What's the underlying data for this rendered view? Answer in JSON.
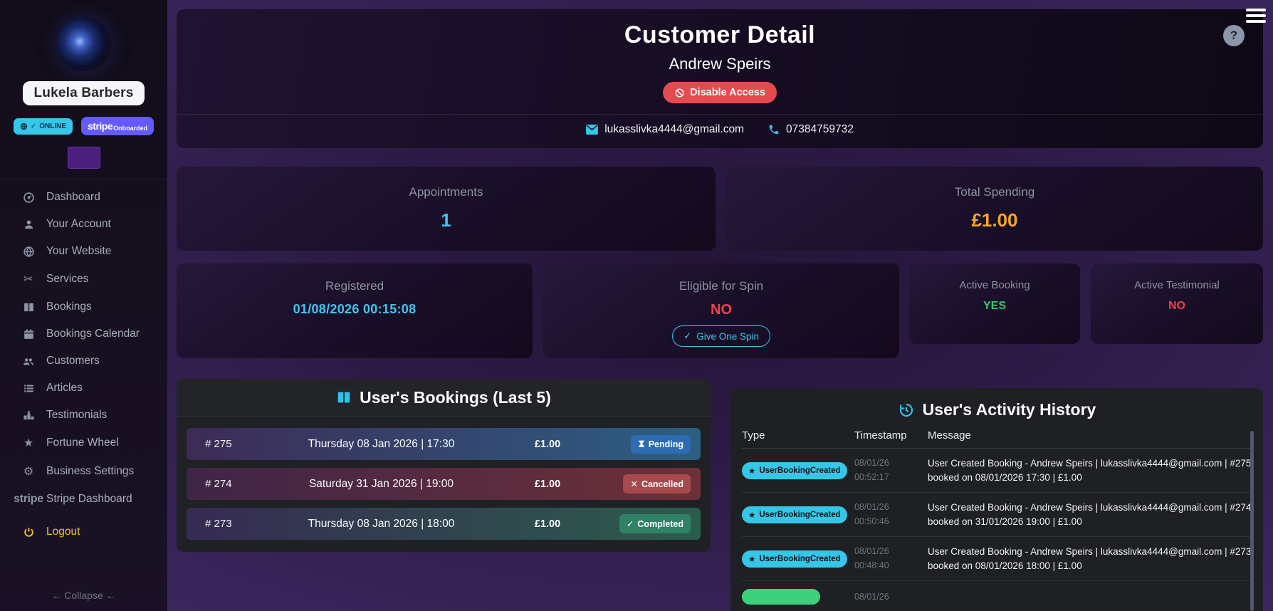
{
  "brand": {
    "name": "Lukela Barbers",
    "online_badge": "ONLINE",
    "stripe_badge_word": "stripe",
    "stripe_badge_sub": "Onboarded"
  },
  "sidebar": {
    "items": [
      {
        "icon": "dashboard",
        "label": "Dashboard"
      },
      {
        "icon": "person",
        "label": "Your Account"
      },
      {
        "icon": "globe",
        "label": "Your Website"
      },
      {
        "icon": "scissors",
        "label": "Services"
      },
      {
        "icon": "book",
        "label": "Bookings"
      },
      {
        "icon": "calendar",
        "label": "Bookings Calendar"
      },
      {
        "icon": "people",
        "label": "Customers"
      },
      {
        "icon": "list",
        "label": "Articles"
      },
      {
        "icon": "podium",
        "label": "Testimonials"
      },
      {
        "icon": "star",
        "label": "Fortune Wheel"
      },
      {
        "icon": "gears",
        "label": "Business Settings"
      },
      {
        "icon": "stripe",
        "label": "Stripe Dashboard",
        "icon_text": "stripe"
      },
      {
        "icon": "power",
        "label": "Logout"
      }
    ],
    "collapse_label": "← Collapse ←"
  },
  "header": {
    "title": "Customer Detail",
    "subtitle": "Andrew Speirs",
    "disable_button_label": "Disable Access",
    "email": "lukasslivka4444@gmail.com",
    "phone": "07384759732"
  },
  "stats": {
    "appointments": {
      "label": "Appointments",
      "value": "1"
    },
    "total_spending": {
      "label": "Total Spending",
      "value": "£1.00"
    },
    "registered": {
      "label": "Registered",
      "value": "01/08/2026 00:15:08"
    },
    "eligible_spin": {
      "label": "Eligible for Spin",
      "value": "NO",
      "button_label": "Give One Spin"
    },
    "active_booking": {
      "label": "Active Booking",
      "value": "YES"
    },
    "active_testimonial": {
      "label": "Active Testimonial",
      "value": "NO"
    }
  },
  "bookings": {
    "title": "User's Bookings (Last 5)",
    "rows": [
      {
        "id": "# 275",
        "datetime": "Thursday 08 Jan 2026 | 17:30",
        "price": "£1.00",
        "status": "Pending"
      },
      {
        "id": "# 274",
        "datetime": "Saturday 31 Jan 2026 | 19:00",
        "price": "£1.00",
        "status": "Cancelled"
      },
      {
        "id": "# 273",
        "datetime": "Thursday 08 Jan 2026 | 18:00",
        "price": "£1.00",
        "status": "Completed"
      }
    ],
    "status_icons": {
      "cancelled": "✕",
      "completed": "✓"
    }
  },
  "activity": {
    "title": "User's Activity History",
    "columns": {
      "type": "Type",
      "timestamp": "Timestamp",
      "message": "Message"
    },
    "badge_star": "★",
    "rows": [
      {
        "type": "UserBookingCreated",
        "date": "08/01/26",
        "time": "00:52:17",
        "message": "User Created Booking - Andrew Speirs | lukasslivka4444@gmail.com | #275 booked on 08/01/2026 17:30 | £1.00"
      },
      {
        "type": "UserBookingCreated",
        "date": "08/01/26",
        "time": "00:50:46",
        "message": "User Created Booking - Andrew Speirs | lukasslivka4444@gmail.com | #274 booked on 31/01/2026 19:00 | £1.00"
      },
      {
        "type": "UserBookingCreated",
        "date": "08/01/26",
        "time": "00:48:40",
        "message": "User Created Booking - Andrew Speirs | lukasslivka4444@gmail.com | #273 booked on 08/01/2026 18:00 | £1.00"
      },
      {
        "type": "",
        "date": "08/01/26",
        "time": "",
        "message": ""
      }
    ]
  },
  "colors": {
    "accent_cyan": "#35c7e8",
    "gold": "#f5a820",
    "green": "#2ecc71",
    "red": "#ef4148",
    "stripe_purple": "#635bff",
    "disable_red": "#e64a4f",
    "pending_badge": "#2d6cb3",
    "cancelled_badge": "#a64a4e",
    "completed_badge": "#2f8263"
  }
}
